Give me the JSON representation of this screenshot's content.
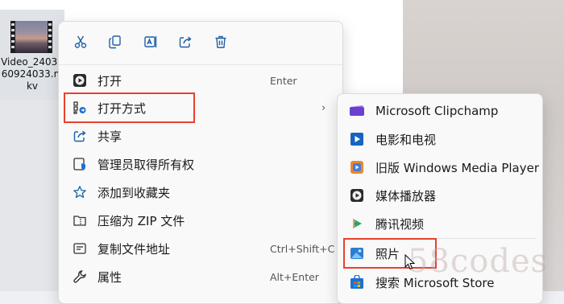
{
  "file": {
    "name": "Video_2403260924033.mkv"
  },
  "toolbar": {
    "buttons": [
      {
        "icon": "cut-icon"
      },
      {
        "icon": "copy-icon"
      },
      {
        "icon": "rename-icon"
      },
      {
        "icon": "share-icon"
      },
      {
        "icon": "delete-icon"
      }
    ]
  },
  "menu": {
    "items": [
      {
        "label": "打开",
        "shortcut": "Enter",
        "icon": "media-play-icon"
      },
      {
        "label": "打开方式",
        "shortcut": "",
        "icon": "open-with-icon",
        "has_submenu": true,
        "highlighted": true
      },
      {
        "label": "共享",
        "shortcut": "",
        "icon": "share-icon"
      },
      {
        "label": "管理员取得所有权",
        "shortcut": "",
        "icon": "admin-ownership-icon"
      },
      {
        "label": "添加到收藏夹",
        "shortcut": "",
        "icon": "star-icon"
      },
      {
        "label": "压缩为 ZIP 文件",
        "shortcut": "",
        "icon": "zip-icon"
      },
      {
        "label": "复制文件地址",
        "shortcut": "Ctrl+Shift+C",
        "icon": "copy-path-icon"
      },
      {
        "label": "属性",
        "shortcut": "Alt+Enter",
        "icon": "wrench-icon"
      }
    ]
  },
  "submenu": {
    "items": [
      {
        "label": "Microsoft Clipchamp",
        "icon": "clipchamp-icon"
      },
      {
        "label": "电影和电视",
        "icon": "movies-tv-icon"
      },
      {
        "label": "旧版 Windows Media Player",
        "icon": "legacy-media-player-icon"
      },
      {
        "label": "媒体播放器",
        "icon": "media-player-icon"
      },
      {
        "label": "腾讯视频",
        "icon": "tencent-video-icon"
      },
      {
        "label": "照片",
        "icon": "photos-icon",
        "highlighted": true
      },
      {
        "label": "搜索 Microsoft Store",
        "icon": "store-icon"
      }
    ]
  },
  "watermark": "58codes",
  "colors": {
    "highlight_border": "#e8412d",
    "menu_bg": "#f9f9f9"
  }
}
